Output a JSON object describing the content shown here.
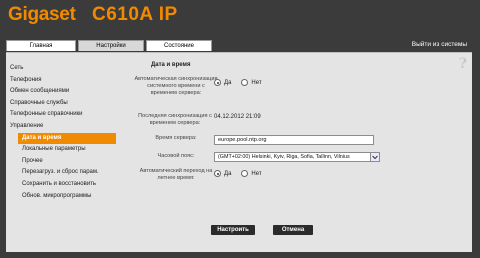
{
  "header": {
    "brand": "Gigaset",
    "model": "C610A IP"
  },
  "tabs": [
    {
      "label": "Главная"
    },
    {
      "label": "Настройки"
    },
    {
      "label": "Состояние"
    }
  ],
  "logout_label": "Выйти из системы",
  "help_glyph": "?",
  "sidebar": {
    "items": [
      {
        "label": "Сеть"
      },
      {
        "label": "Телефония"
      },
      {
        "label": "Обмен сообщениями"
      },
      {
        "label": "Справочные службы"
      },
      {
        "label": "Телефонные справочники"
      },
      {
        "label": "Управление"
      }
    ],
    "subitems": [
      {
        "label": "Дата и время"
      },
      {
        "label": "Локальные параметры"
      },
      {
        "label": "Прочее"
      },
      {
        "label": "Перезагруз. и сброс парам."
      },
      {
        "label": "Сохранить и восстановить"
      },
      {
        "label": "Обнов. микропрограммы"
      }
    ]
  },
  "content": {
    "section_title": "Дата и время",
    "sync": {
      "label": "Автоматическая синхронизация системного времени с временем сервера:",
      "yes": "Да",
      "no": "Нет",
      "selected": "yes"
    },
    "last_sync": {
      "label": "Последняя синхронизация с временем сервера:",
      "value": "04.12.2012 21:09"
    },
    "server": {
      "label": "Время сервера:",
      "value": "europe.pool.ntp.org"
    },
    "timezone": {
      "label": "Часовой пояс:",
      "value": "(GMT+02:00) Helsinki, Kyiv, Riga, Sofia, Tallinn, Vilnius"
    },
    "dst": {
      "label": "Автоматический переход на летнее время:",
      "yes": "Да",
      "no": "Нет",
      "selected": "yes"
    }
  },
  "buttons": {
    "apply": "Настроить",
    "cancel": "Отмена"
  },
  "colors": {
    "accent": "#f08a00",
    "background": "#3b3b3b",
    "panel": "#e4e4e4"
  }
}
